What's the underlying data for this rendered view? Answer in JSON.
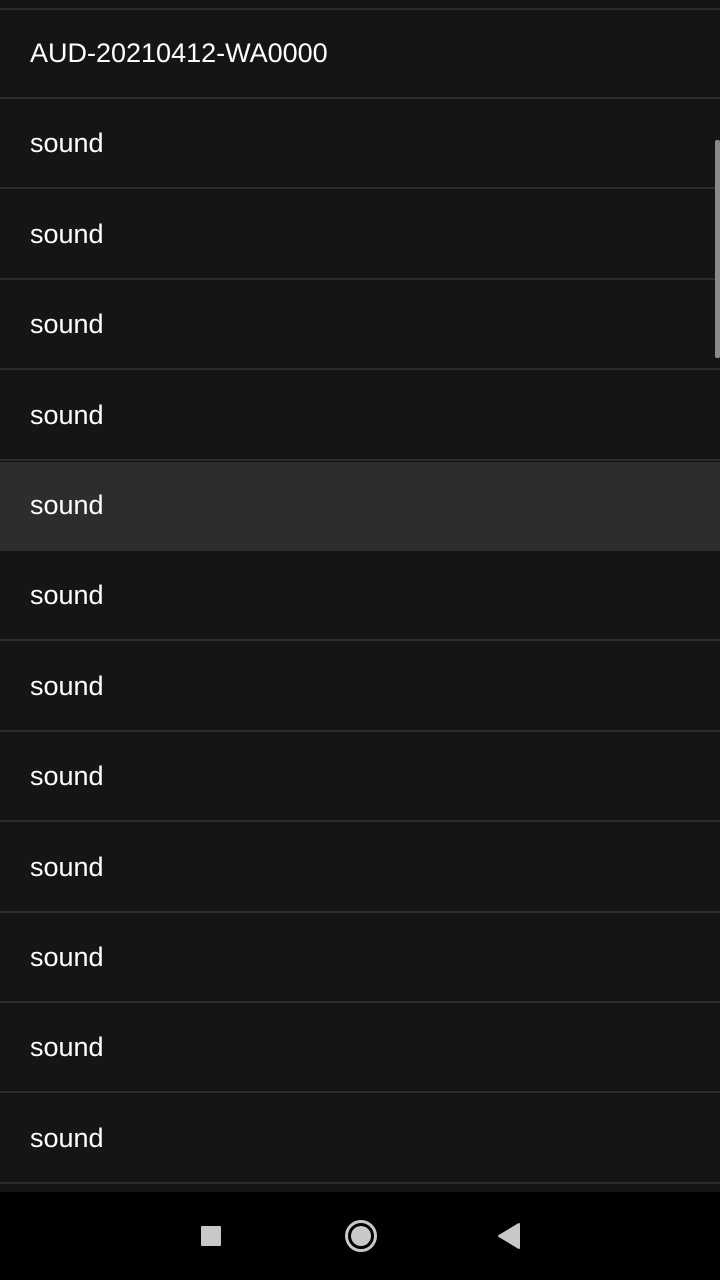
{
  "list": {
    "items": [
      {
        "label": "AUD-20210412-WA0000"
      },
      {
        "label": "sound"
      },
      {
        "label": "sound"
      },
      {
        "label": "sound"
      },
      {
        "label": "sound"
      },
      {
        "label": "sound",
        "highlighted": true
      },
      {
        "label": "sound"
      },
      {
        "label": "sound"
      },
      {
        "label": "sound"
      },
      {
        "label": "sound"
      },
      {
        "label": "sound"
      },
      {
        "label": "sound"
      },
      {
        "label": "sound"
      }
    ]
  },
  "navbar": {
    "recents_icon": "square-icon",
    "home_icon": "circle-icon",
    "back_icon": "triangle-back-icon"
  },
  "colors": {
    "background": "#151516",
    "highlight": "#2d2d2e",
    "divider": "#2c2c2d",
    "text": "#ffffff",
    "navbar": "#000000",
    "nav_icon": "#c8c8c8"
  }
}
